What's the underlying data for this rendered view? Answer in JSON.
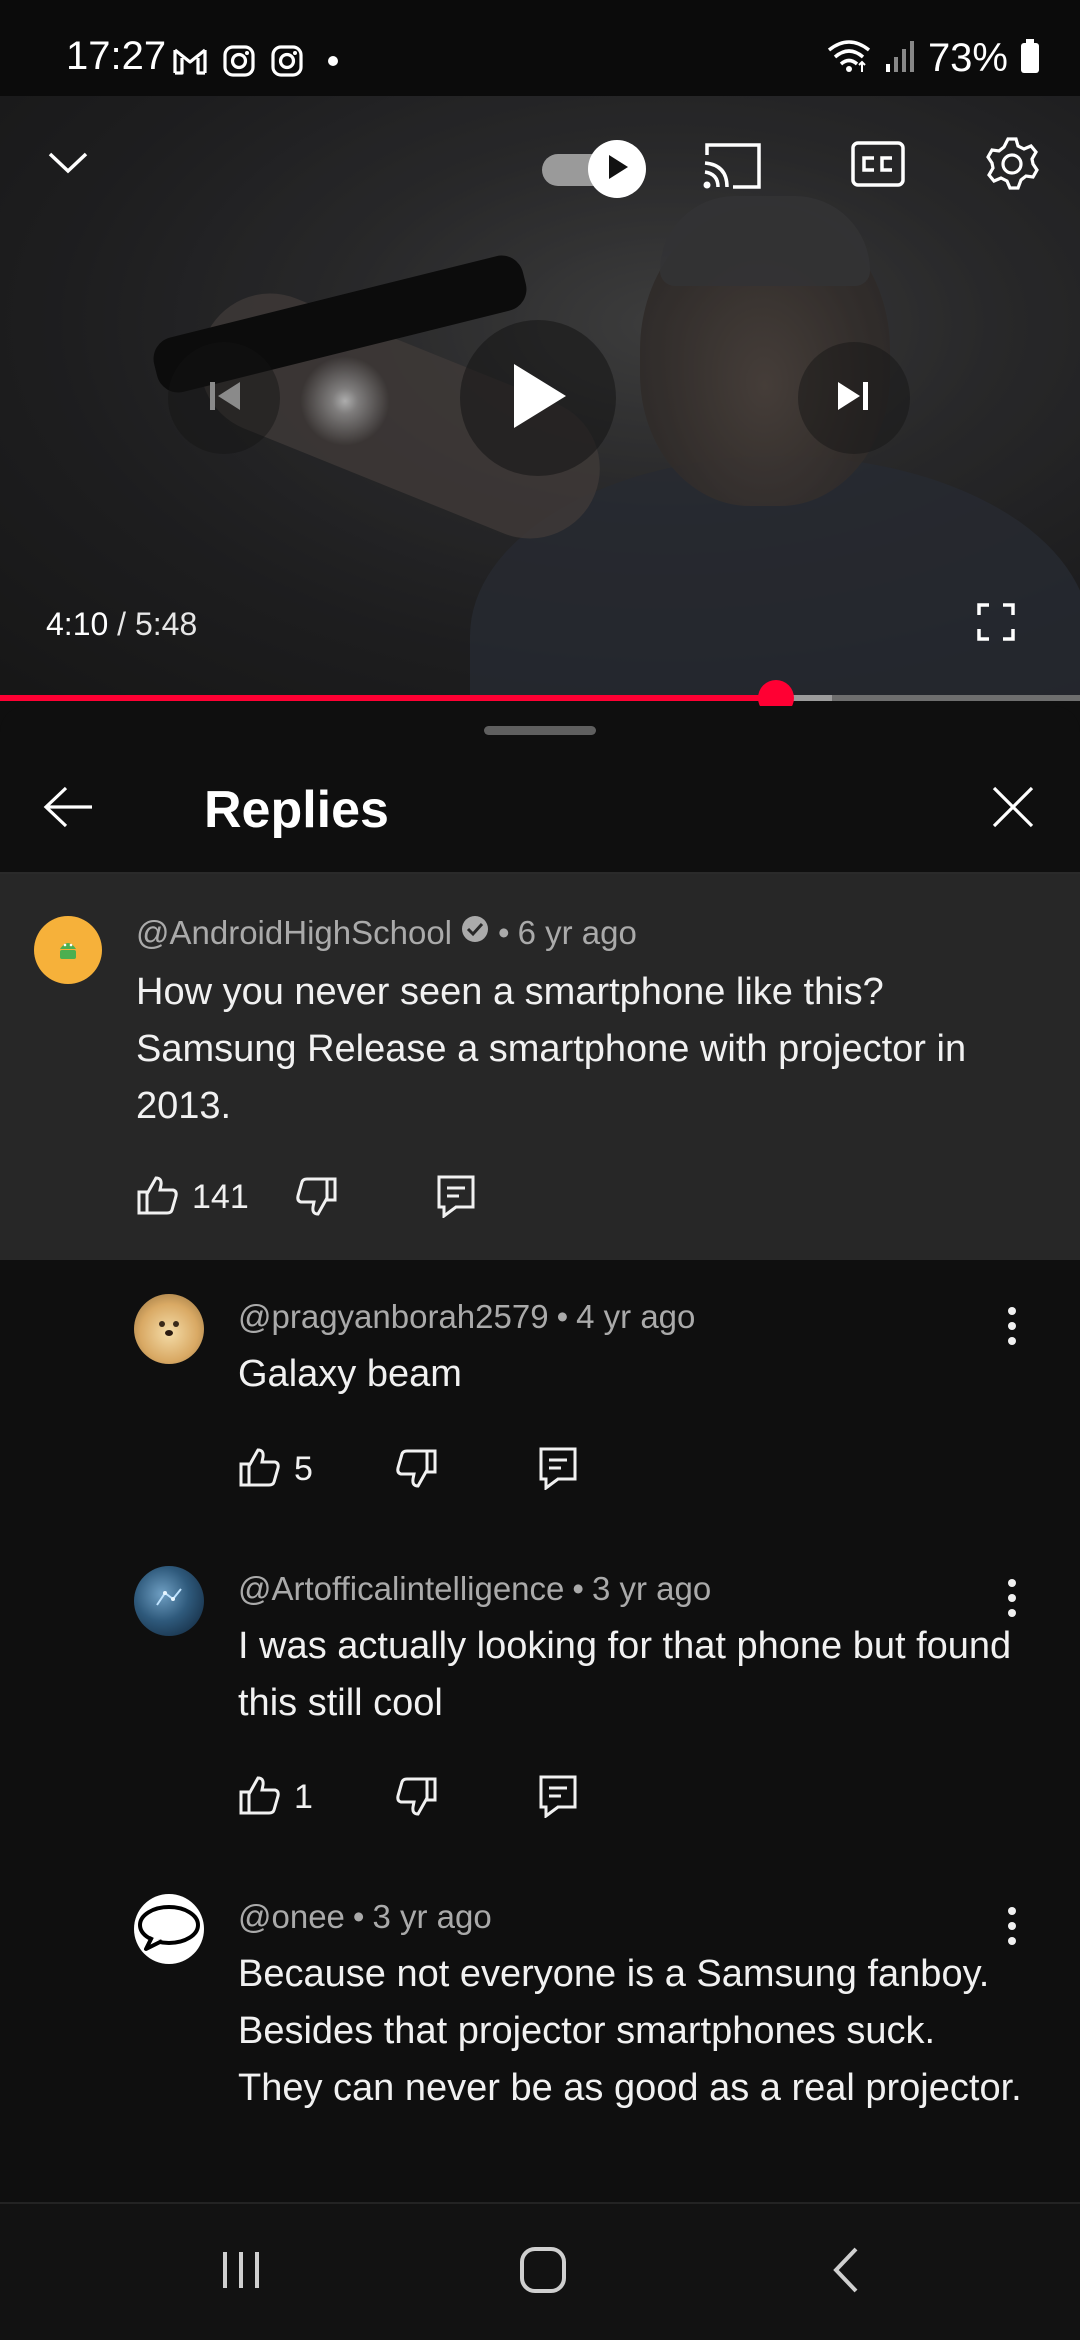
{
  "status_bar": {
    "time": "17:27",
    "battery": "73%",
    "left_icons": [
      "gmail-icon",
      "instagram-icon",
      "instagram-icon",
      "dot-icon"
    ],
    "right_icons": [
      "wifi-icon",
      "signal-icon",
      "battery-icon"
    ]
  },
  "player": {
    "current_time": "4:10",
    "separator": " / ",
    "duration": "5:48",
    "progress_fraction": 0.72,
    "autoplay_on": true,
    "accent_color": "#ff0033"
  },
  "replies_panel": {
    "title": "Replies",
    "parent_comment": {
      "handle": "@AndroidHighSchool",
      "verified": true,
      "time": "6 yr ago",
      "text": "How you never seen a smartphone like this? Samsung Release a smartphone with projector in 2013.",
      "likes": "141"
    },
    "replies": [
      {
        "handle": "@pragyanborah2579",
        "time": "4 yr ago",
        "text": "Galaxy beam",
        "likes": "5"
      },
      {
        "handle": "@Artofficalintelligence",
        "time": "3 yr ago",
        "text": "I was actually looking for that phone but found this still cool",
        "likes": "1"
      },
      {
        "handle": "@onee",
        "time": "3 yr ago",
        "text": "Because not everyone is a Samsung fanboy. Besides that projector smartphones suck. They can never be as good as a real projector."
      }
    ]
  },
  "meta_separator": "•"
}
